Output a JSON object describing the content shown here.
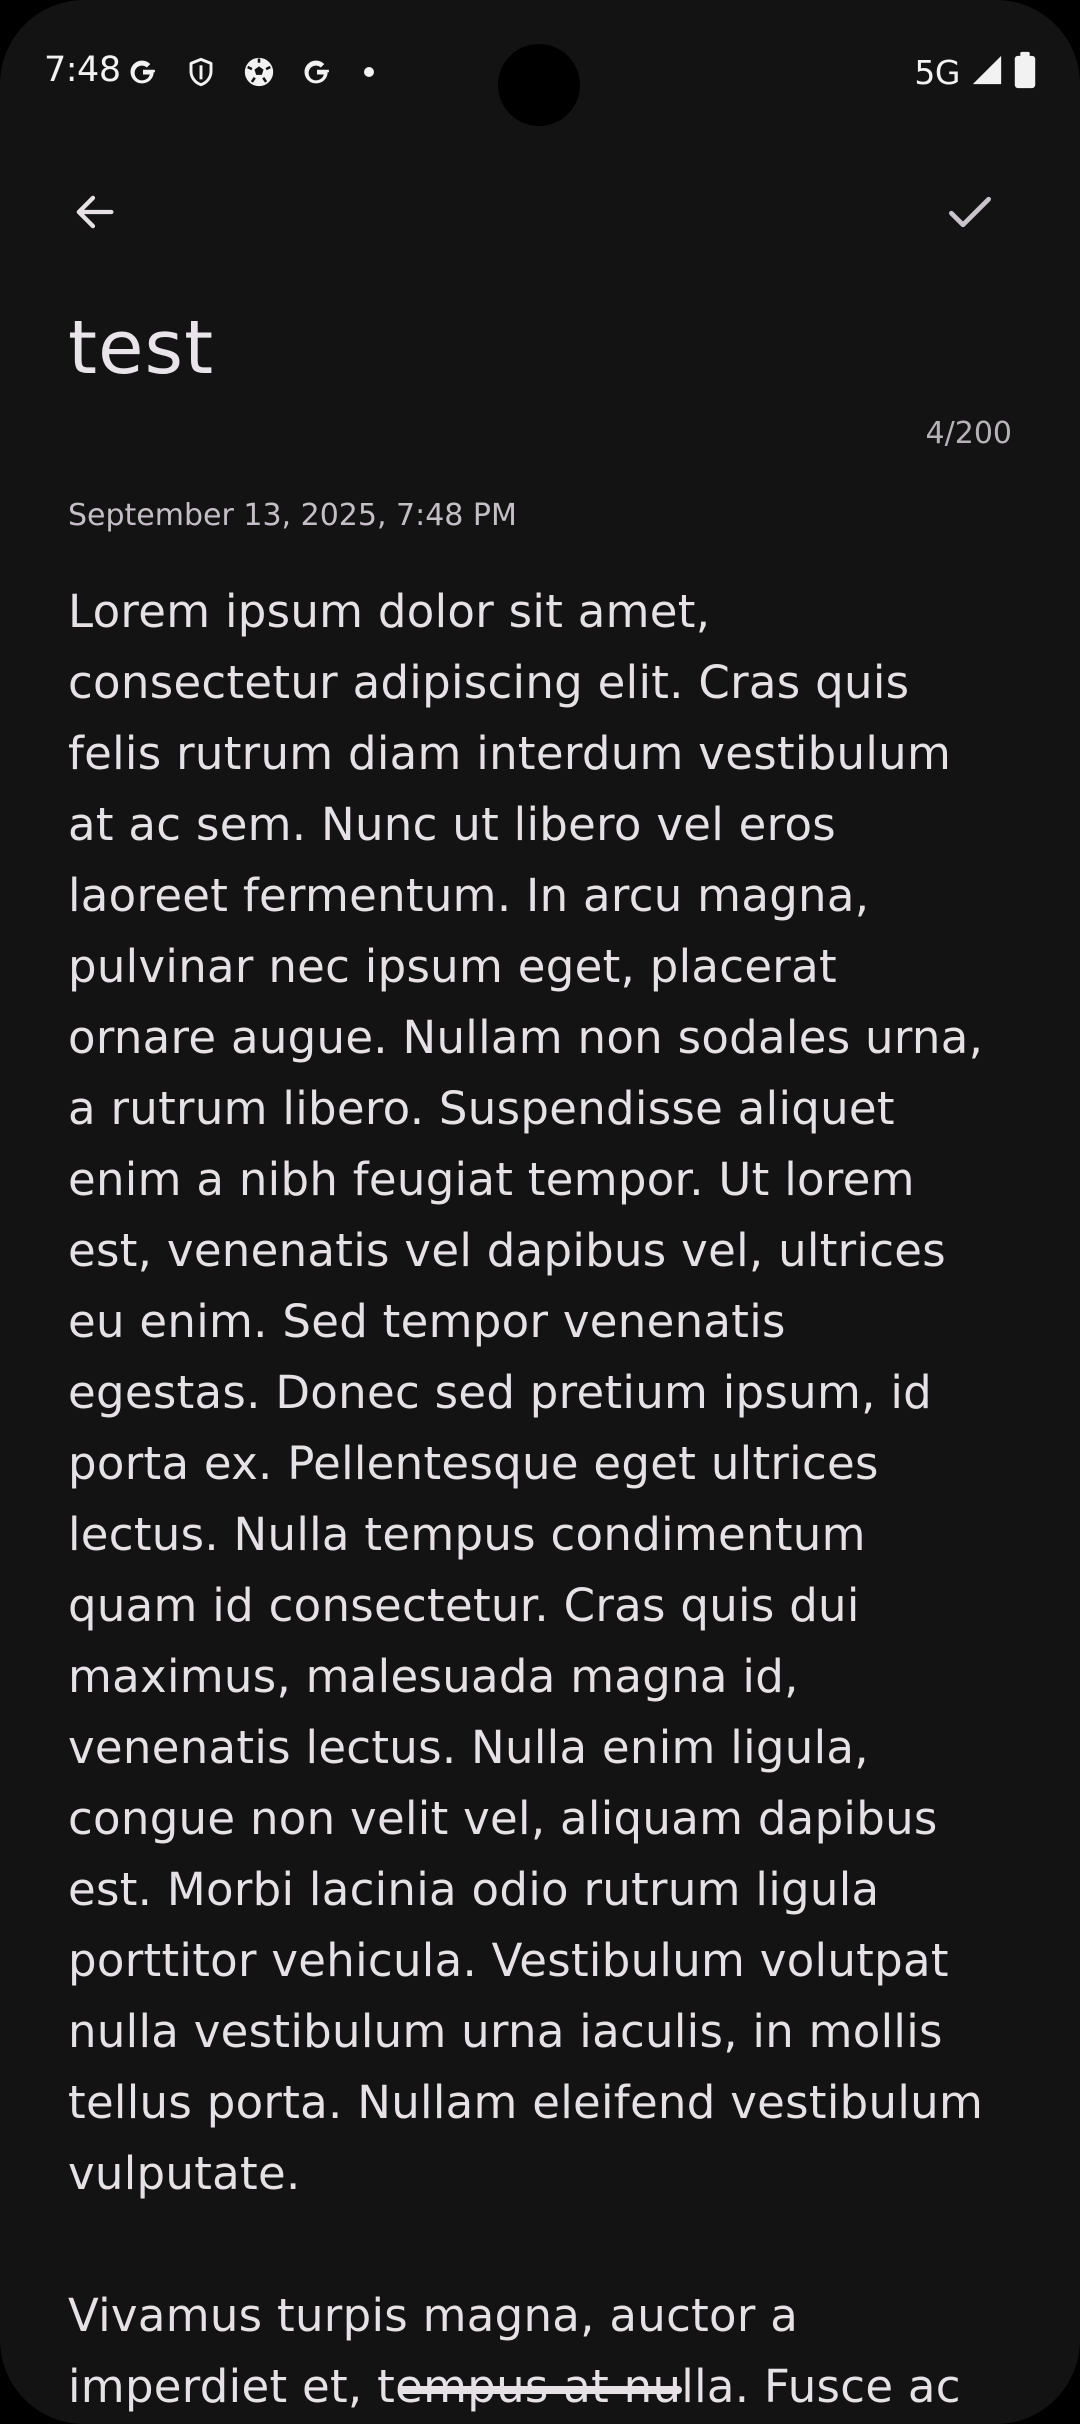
{
  "status_bar": {
    "time": "7:48",
    "left_icons": [
      "google-g-icon",
      "shield-icon",
      "soccer-ball-icon",
      "google-g-icon",
      "notification-dot-icon"
    ],
    "network": "5G",
    "right_icons": [
      "cell-signal-icon",
      "battery-icon"
    ]
  },
  "toolbar": {
    "back_icon": "arrow-back-icon",
    "save_icon": "checkmark-icon"
  },
  "note": {
    "title": "test",
    "char_count": "4/200",
    "date": "September 13, 2025, 7:48 PM",
    "body": "Lorem ipsum dolor sit amet,\nconsectetur adipiscing elit. Cras quis\nfelis rutrum diam interdum vestibulum\nat ac sem. Nunc ut libero vel eros\nlaoreet fermentum. In arcu magna,\npulvinar nec ipsum eget, placerat\nornare augue. Nullam non sodales urna,\na rutrum libero. Suspendisse aliquet\nenim a nibh feugiat tempor. Ut lorem\nest, venenatis vel dapibus vel, ultrices\neu enim. Sed tempor venenatis\negestas. Donec sed pretium ipsum, id\nporta ex. Pellentesque eget ultrices\nlectus. Nulla tempus condimentum\nquam id consectetur. Cras quis dui\nmaximus, malesuada magna id,\nvenenatis lectus. Nulla enim ligula,\ncongue non velit vel, aliquam dapibus\nest. Morbi lacinia odio rutrum ligula\nporttitor vehicula. Vestibulum volutpat\nnulla vestibulum urna iaculis, in mollis\ntellus porta. Nullam eleifend vestibulum\nvulputate.\n\nVivamus turpis magna, auctor a\nimperdiet et, tempus at nulla. Fusce ac"
  },
  "colors": {
    "background": "#131313",
    "text": "#e6e1e5",
    "secondary_text": "#c4bfc6"
  }
}
